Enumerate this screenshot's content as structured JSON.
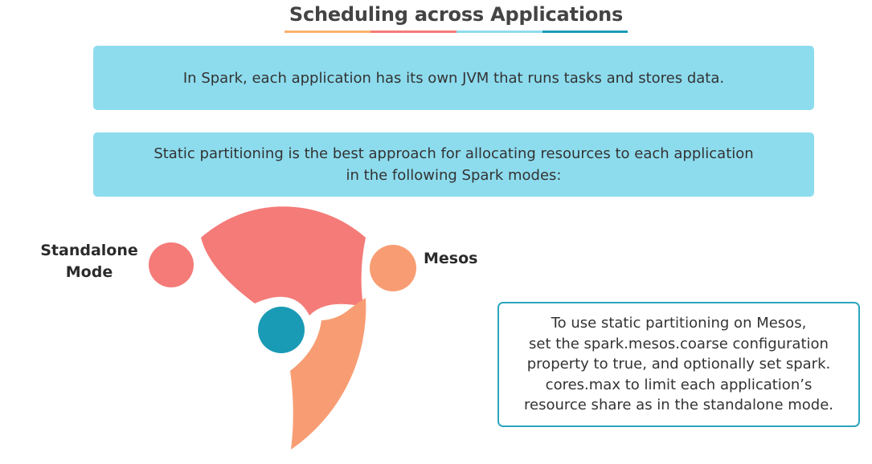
{
  "title": "Scheduling across Applications",
  "banners": [
    {
      "text": "In Spark, each application has its own JVM that runs tasks and stores data."
    },
    {
      "lines": [
        "Static partitioning is the best approach for allocating resources to each application",
        "in the following Spark modes:"
      ]
    }
  ],
  "diagram": {
    "labels": {
      "standalone": [
        "Standalone",
        "Mode"
      ],
      "mesos": "Mesos"
    }
  },
  "note": {
    "lines": [
      "To use static partitioning on Mesos,",
      "set the spark.mesos.coarse configuration",
      "property to true, and optionally set spark.",
      "cores.max to limit each application’s",
      "resource share as in the standalone mode."
    ]
  },
  "colors": {
    "banner": "#8ddcee",
    "standalone": "#f47b78",
    "mesos": "#f89d73",
    "center": "#1a9bb5",
    "note_border": "#2ba6bc",
    "underline": [
      "#f9b26b",
      "#f47b78",
      "#8ddcee",
      "#1a9bb5"
    ]
  }
}
